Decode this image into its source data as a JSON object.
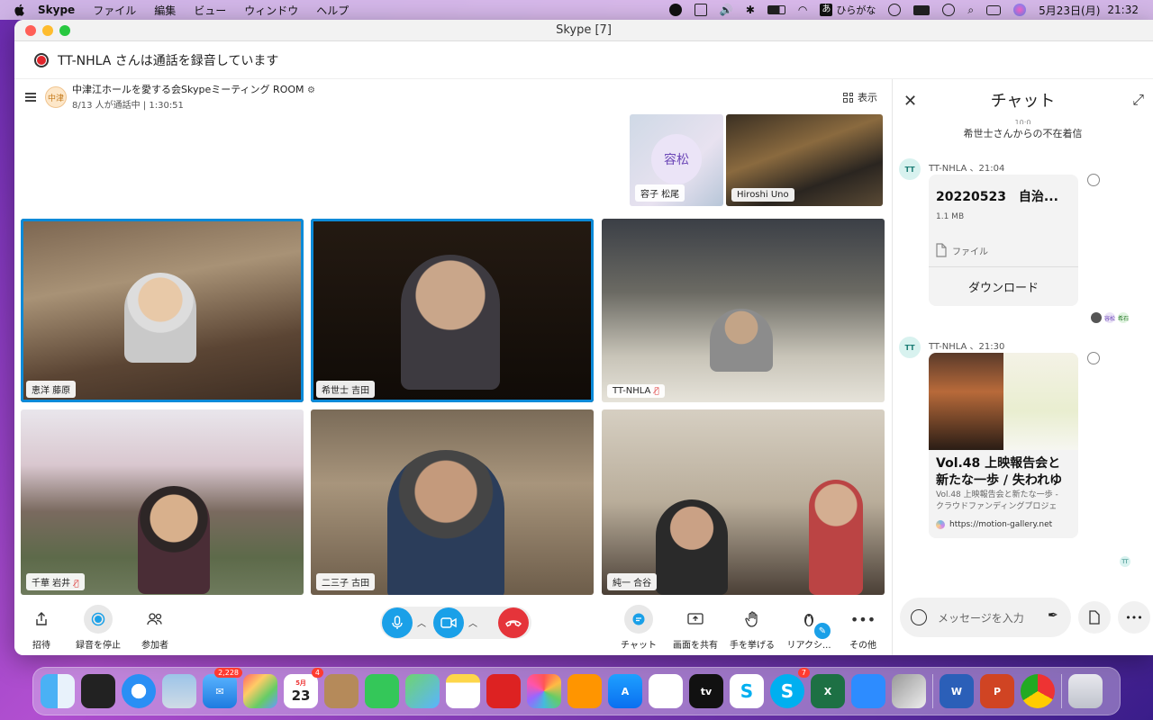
{
  "menubar": {
    "app": "Skype",
    "items": [
      "ファイル",
      "編集",
      "ビュー",
      "ウィンドウ",
      "ヘルプ"
    ],
    "ime_char": "あ",
    "ime_label": "ひらがな",
    "date": "5月23日(月)",
    "time": "21:32"
  },
  "window": {
    "title": "Skype [7]",
    "recording_notice": "TT-NHLA さんは通話を録音しています"
  },
  "call": {
    "room_avatar": "中津",
    "room_title": "中津江ホールを愛する会Skypeミーティング ROOM",
    "room_status": "8/13 人が通話中 | 1:30:51",
    "view_label": "表示",
    "small_tiles": [
      {
        "name": "容子 松尾",
        "avatar": "容松"
      },
      {
        "name": "Hiroshi Uno"
      }
    ],
    "tiles": [
      {
        "name": "恵洋 藤原"
      },
      {
        "name": "希世士 吉田"
      },
      {
        "name": "TT-NHLA",
        "muted": true
      },
      {
        "name": "千華 岩井",
        "muted": true
      },
      {
        "name": "二三子 古田"
      },
      {
        "name": "純一 合谷"
      }
    ]
  },
  "toolbar": {
    "invite": "招待",
    "stop_recording": "録音を停止",
    "participants": "参加者",
    "chat": "チャット",
    "share_screen": "画面を共有",
    "raise_hand": "手を挙げる",
    "reactions": "リアクシ...",
    "more": "その他"
  },
  "chat": {
    "title": "チャット",
    "partial_time": "10:0",
    "missed_call": "希世士さんからの不在着信",
    "messages": [
      {
        "avatar": "TT",
        "header": "TT-NHLA 、21:04",
        "file_name": "20220523　自治...",
        "file_size": "1.1 MB",
        "file_type": "ファイル",
        "download": "ダウンロード",
        "read_by": [
          "容松",
          "希石"
        ]
      },
      {
        "avatar": "TT",
        "header": "TT-NHLA 、21:30",
        "link_title": "Vol.48 上映報告会と新たな一歩 / 失われゆ",
        "link_desc_1": "Vol.48 上映報告会と新たな一歩 -",
        "link_desc_2": "クラウドファンディングプロジェ",
        "link_url": "https://motion-gallery.net",
        "read_by": [
          "TT"
        ]
      }
    ],
    "input_placeholder": "メッセージを入力"
  },
  "dock": {
    "mail_badge": "2,228",
    "calendar_month": "5月",
    "calendar_day": "23",
    "calendar_badge": "4",
    "skype_badge": "7"
  },
  "colors": {
    "skype_blue": "#1aa0e8",
    "end_call_red": "#e5343a",
    "active_speaker": "#0b8ad8"
  }
}
